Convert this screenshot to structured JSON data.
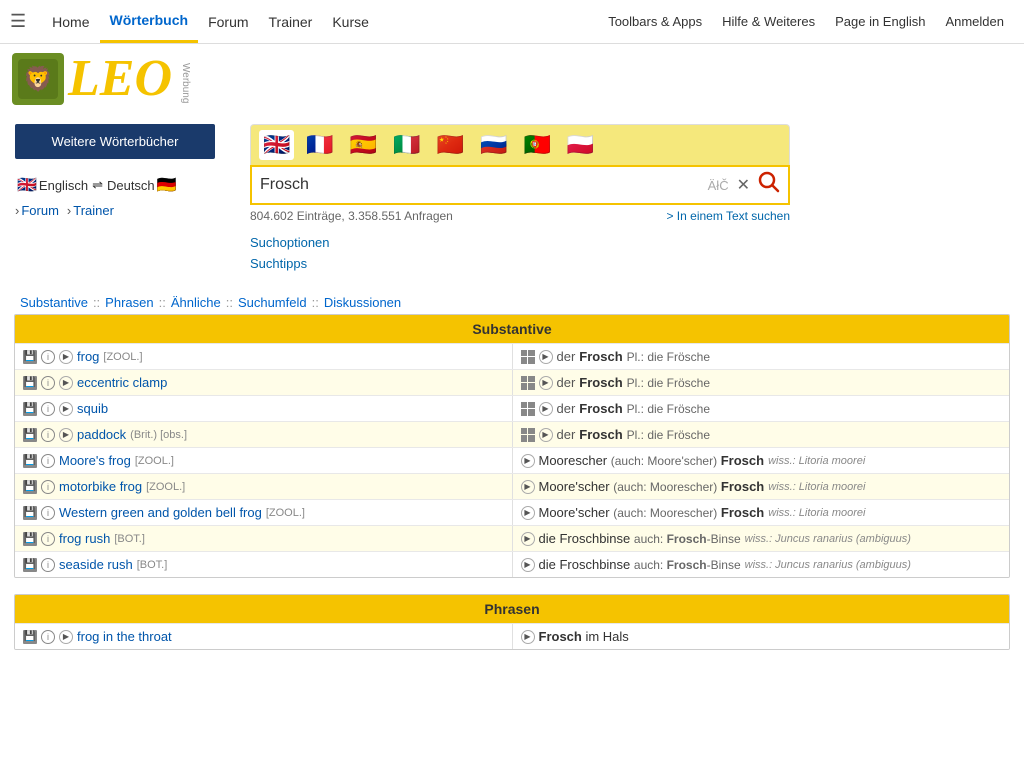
{
  "nav": {
    "hamburger": "☰",
    "links": [
      {
        "label": "Home",
        "active": false
      },
      {
        "label": "Wörterbuch",
        "active": true
      },
      {
        "label": "Forum",
        "active": false
      },
      {
        "label": "Trainer",
        "active": false
      },
      {
        "label": "Kurse",
        "active": false
      }
    ],
    "right_links": [
      {
        "label": "Toolbars & Apps"
      },
      {
        "label": "Hilfe & Weiteres"
      },
      {
        "label": "Page in English"
      },
      {
        "label": "Anmelden"
      }
    ]
  },
  "logo": {
    "lion": "🦁",
    "text": "LEO",
    "werbung": "Werbung"
  },
  "sidebar": {
    "btn": "Weitere Wörterbücher",
    "lang_from": "Englisch",
    "lang_to": "Deutsch",
    "sub_links": [
      "Forum",
      "Trainer"
    ]
  },
  "search": {
    "flags": [
      "🇬🇧",
      "🇫🇷",
      "🇪🇸",
      "🇮🇹",
      "🇨🇳",
      "🇷🇺",
      "🇵🇹",
      "🇵🇱"
    ],
    "query": "Frosch",
    "atc": "ÄłČ",
    "stats": "804.602 Einträge, 3.358.551 Anfragen",
    "in_text": "> In einem Text suchen",
    "suchoptionen": "Suchoptionen",
    "suchtipps": "Suchtipps"
  },
  "result_tabs": {
    "items": [
      "Substantive",
      "Phrasen",
      "Ähnliche",
      "Suchumfeld",
      "Diskussionen"
    ],
    "sep": "::"
  },
  "substantive": {
    "header": "Substantive",
    "rows": [
      {
        "en": "frog",
        "en_tag": "[ZOOL.]",
        "de_article": "der",
        "de_word": "Frosch",
        "de_extra": "Pl.: die Frösche",
        "has_grid": true,
        "has_play_en": true,
        "has_play_de": true
      },
      {
        "en": "eccentric clamp",
        "en_tag": "",
        "de_article": "der",
        "de_word": "Frosch",
        "de_extra": "Pl.: die Frösche",
        "has_grid": true,
        "has_play_en": true,
        "has_play_de": true
      },
      {
        "en": "squib",
        "en_tag": "",
        "de_article": "der",
        "de_word": "Frosch",
        "de_extra": "Pl.: die Frösche",
        "has_grid": true,
        "has_play_en": true,
        "has_play_de": true
      },
      {
        "en": "paddock",
        "en_tag": "(Brit.) [obs.]",
        "de_article": "der",
        "de_word": "Frosch",
        "de_extra": "Pl.: die Frösche",
        "has_grid": true,
        "has_play_en": true,
        "has_play_de": true
      },
      {
        "en": "Moore's frog",
        "en_tag": "[ZOOL.]",
        "de_article": "",
        "de_word": "Moorescher",
        "de_also": "(auch: Moore'scher)",
        "de_bold": "Frosch",
        "de_wiss": "wiss.: Litoria moorei",
        "has_play_de": false
      },
      {
        "en": "motorbike frog",
        "en_tag": "[ZOOL.]",
        "de_article": "",
        "de_word": "Moore'scher",
        "de_also": "(auch: Moorescher)",
        "de_bold": "Frosch",
        "de_wiss": "wiss.: Litoria moorei",
        "has_play_de": false
      },
      {
        "en": "Western green and golden bell frog",
        "en_tag": "[ZOOL.]",
        "de_article": "",
        "de_word": "Moore'scher",
        "de_also": "(auch: Moorescher)",
        "de_bold": "Frosch",
        "de_wiss": "wiss.: Litoria moorei",
        "has_play_de": false
      },
      {
        "en": "frog rush",
        "en_tag": "[BOT.]",
        "de_article": "die",
        "de_word": "Froschbinse",
        "de_also": "auch:",
        "de_bold2": "Frosch",
        "de_bold2_rest": "-Binse",
        "de_wiss": "wiss.: Juncus ranarius (ambiguus)",
        "has_play_de": false
      },
      {
        "en": "seaside rush",
        "en_tag": "[BOT.]",
        "de_article": "die",
        "de_word": "Froschbinse",
        "de_also": "auch:",
        "de_bold2": "Frosch",
        "de_bold2_rest": "-Binse",
        "de_wiss": "wiss.: Juncus ranarius (ambiguus)",
        "has_play_de": false
      }
    ]
  },
  "phrasen": {
    "header": "Phrasen",
    "rows": [
      {
        "en": "frog in the throat",
        "de_bold": "Frosch",
        "de_rest": " im Hals"
      }
    ]
  }
}
